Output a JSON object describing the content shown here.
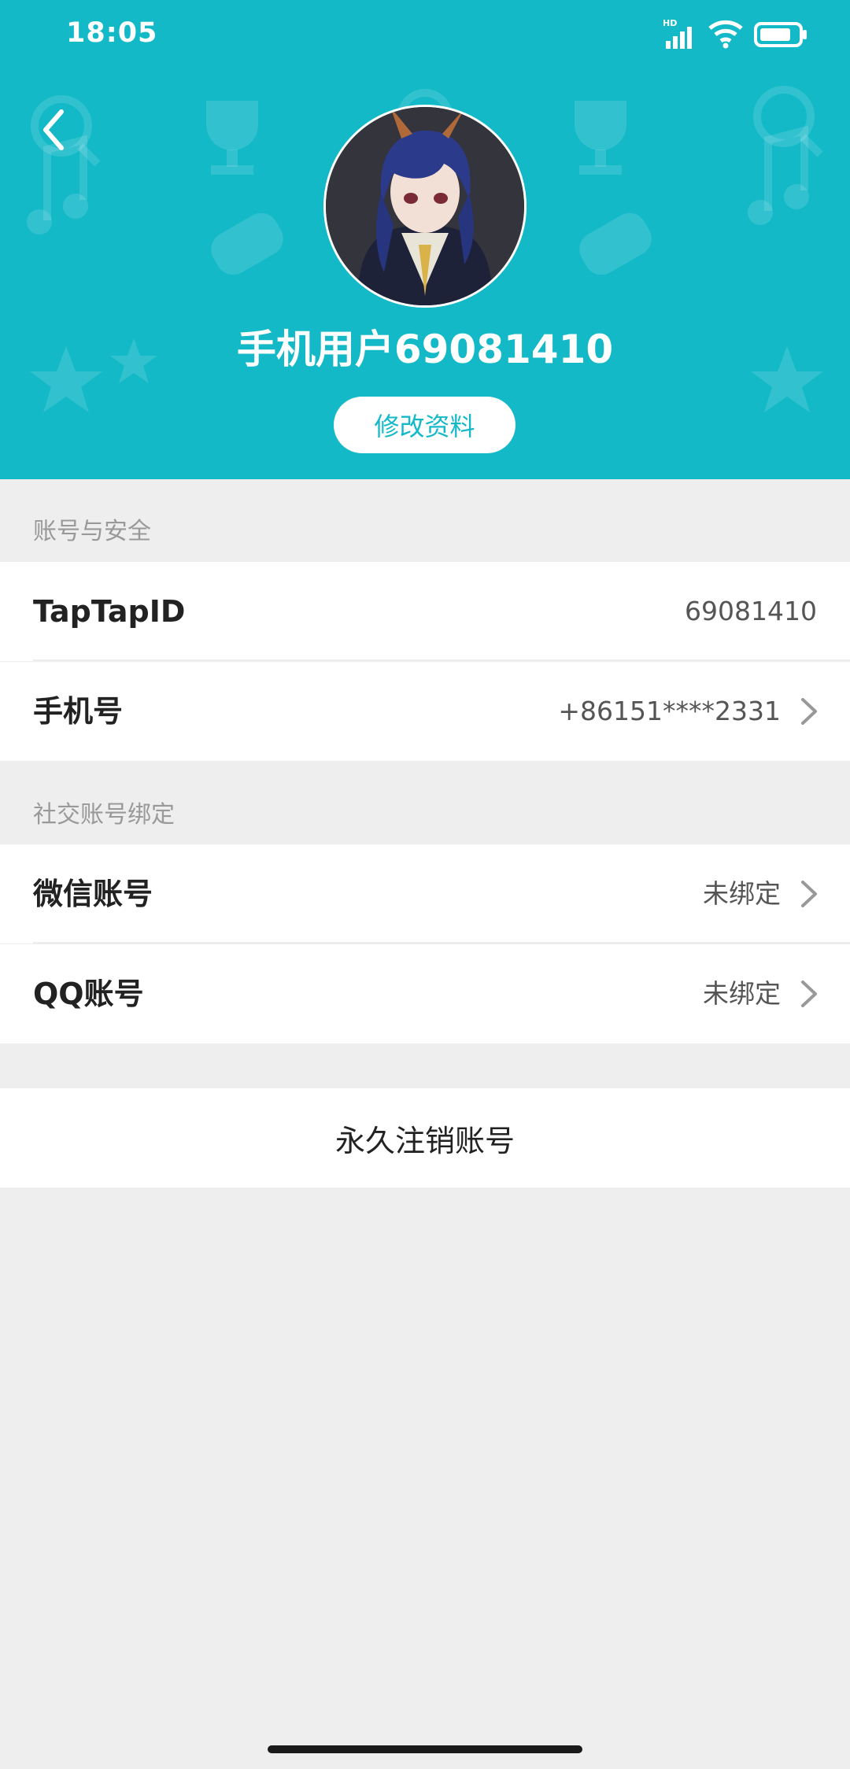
{
  "status_bar": {
    "time": "18:05",
    "network_label": "HD"
  },
  "header": {
    "username": "手机用户69081410",
    "edit_button_label": "修改资料",
    "background_color": "#14b9c8"
  },
  "sections": {
    "account_security": {
      "label": "账号与安全",
      "rows": [
        {
          "title": "TapTapID",
          "value": "69081410"
        },
        {
          "title": "手机号",
          "value": "+86151****2331"
        }
      ]
    },
    "social_binding": {
      "label": "社交账号绑定",
      "rows": [
        {
          "title": "微信账号",
          "value": "未绑定"
        },
        {
          "title": "QQ账号",
          "value": "未绑定"
        }
      ]
    }
  },
  "delete_account_label": "永久注销账号",
  "icons": [
    "back-arrow-icon",
    "chevron-right-icon",
    "signal-icon",
    "wifi-icon",
    "battery-icon"
  ]
}
